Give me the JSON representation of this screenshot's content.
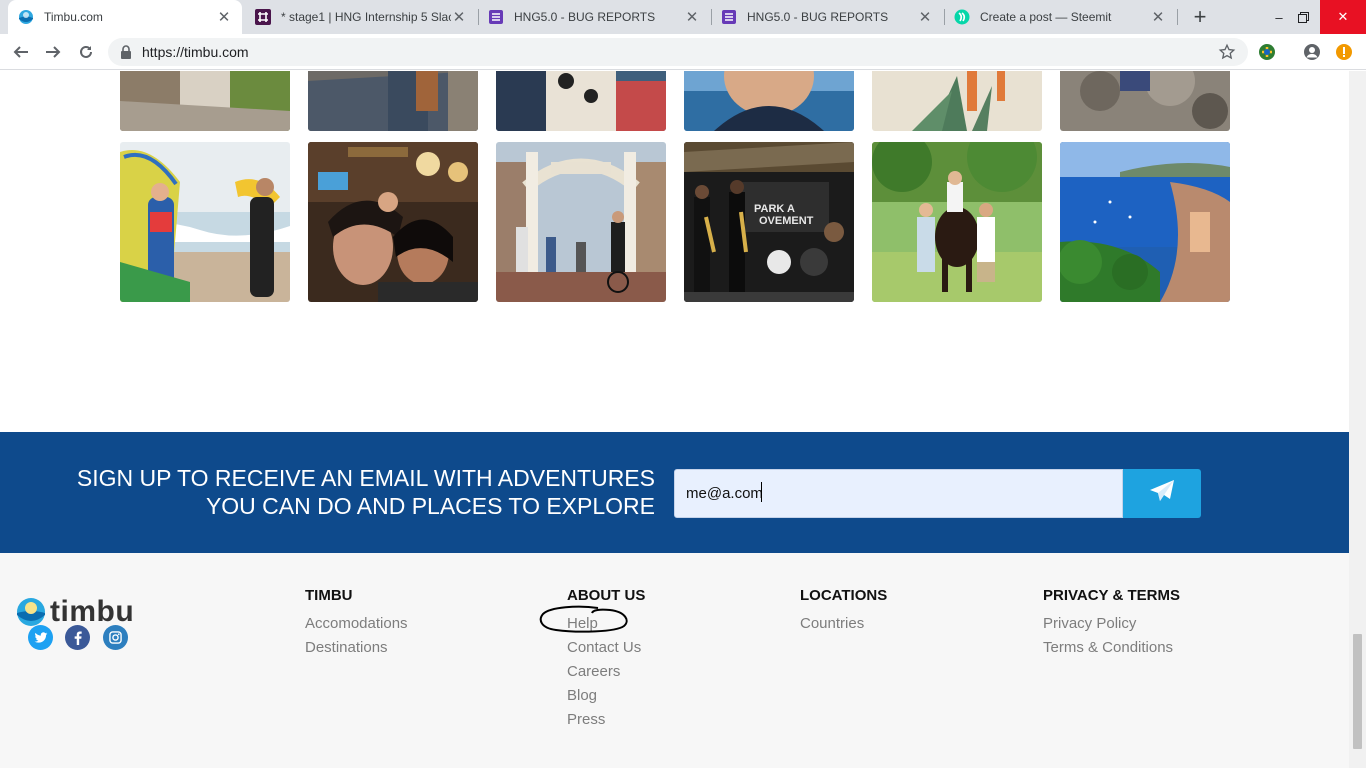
{
  "browser": {
    "tabs": [
      {
        "title": "Timbu.com",
        "icon": "timbu-favicon",
        "active": true
      },
      {
        "title": "* stage1 | HNG Internship 5 Slac",
        "icon": "slack-favicon",
        "active": false
      },
      {
        "title": "HNG5.0 - BUG REPORTS",
        "icon": "sheets-favicon",
        "active": false
      },
      {
        "title": "HNG5.0 - BUG REPORTS",
        "icon": "sheets-favicon",
        "active": false
      },
      {
        "title": "Create a post — Steemit",
        "icon": "steemit-favicon",
        "active": false
      }
    ],
    "url": "https://timbu.com",
    "colors": {
      "tabbar": "#dee1e6",
      "close_hover": "#e81123"
    }
  },
  "gallery": {
    "row1": [
      "surfers-top-photo",
      "alley-woman-photo",
      "market-stall-photo",
      "boat-selfie-photo",
      "agave-beach-photo",
      "rocky-ground-photo"
    ],
    "row2": [
      "surfers-photo",
      "bar-selfie-photo",
      "canal-bridge-cyclists-photo",
      "jazz-band-photo",
      "horse-riders-photo",
      "coastal-bay-photo"
    ],
    "jazz_sign_text": "PARK A\nOVEMENT"
  },
  "signup": {
    "heading_line1": "SIGN UP TO RECEIVE AN EMAIL WITH ADVENTURES",
    "heading_line2": "YOU CAN DO AND PLACES TO EXPLORE",
    "email_value": "me@a.com",
    "send_icon": "paper-plane-icon",
    "colors": {
      "band": "#0e4a8c",
      "button": "#1ea3e0",
      "input_bg": "#e8f0fe"
    }
  },
  "footer": {
    "brand": "timbu",
    "social": [
      "twitter-icon",
      "facebook-icon",
      "instagram-icon"
    ],
    "columns": [
      {
        "heading": "TIMBU",
        "links": [
          "Accomodations",
          "Destinations"
        ]
      },
      {
        "heading": "ABOUT US",
        "links": [
          "Help",
          "Contact Us",
          "Careers",
          "Blog",
          "Press"
        ]
      },
      {
        "heading": "LOCATIONS",
        "links": [
          "Countries"
        ]
      },
      {
        "heading": "PRIVACY & TERMS",
        "links": [
          "Privacy Policy",
          "Terms & Conditions"
        ]
      }
    ],
    "annotation": "hand-drawn circle around Help"
  }
}
